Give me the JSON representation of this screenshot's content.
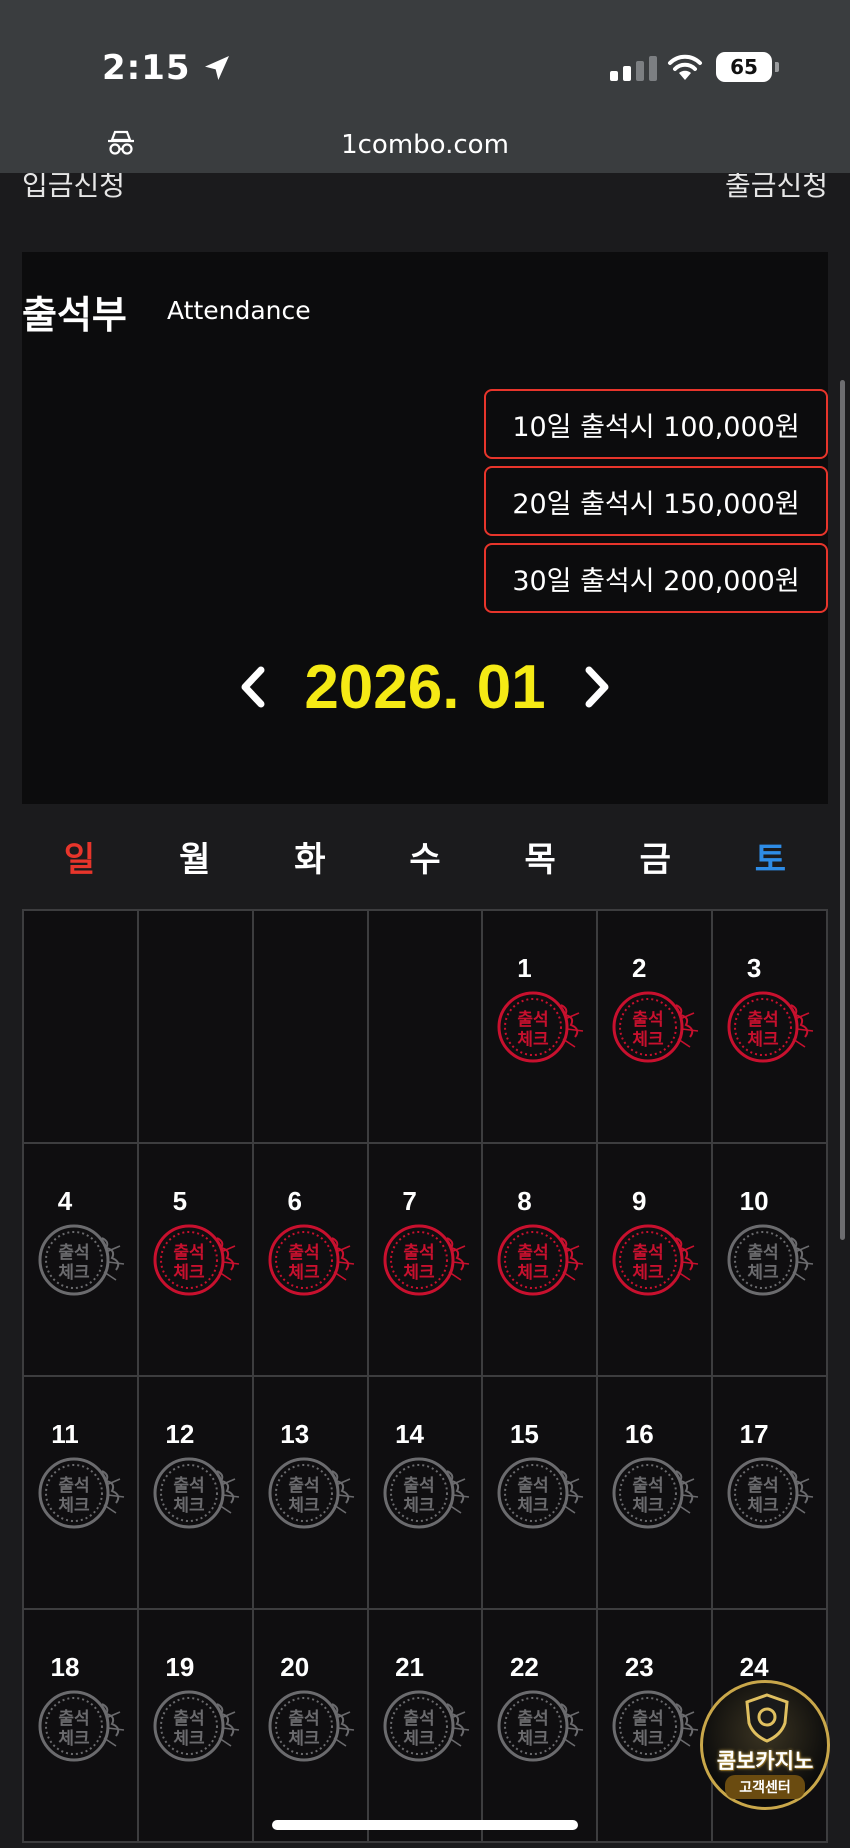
{
  "status_bar": {
    "time": "2:15",
    "battery": "65"
  },
  "browser": {
    "url": "1combo.com"
  },
  "top_links": {
    "left": "입금신청",
    "right": "출금신청"
  },
  "attendance": {
    "title": "출석부",
    "subtitle": "Attendance",
    "rewards": [
      "10일 출석시 100,000원",
      "20일 출석시 150,000원",
      "30일 출석시 200,000원"
    ],
    "month": "2026. 01"
  },
  "weekdays": [
    "일",
    "월",
    "화",
    "수",
    "목",
    "금",
    "토"
  ],
  "calendar": {
    "leading_blanks": 4,
    "days": [
      {
        "day": "1",
        "checked": true
      },
      {
        "day": "2",
        "checked": true
      },
      {
        "day": "3",
        "checked": true
      },
      {
        "day": "4",
        "checked": false
      },
      {
        "day": "5",
        "checked": true
      },
      {
        "day": "6",
        "checked": true
      },
      {
        "day": "7",
        "checked": true
      },
      {
        "day": "8",
        "checked": true
      },
      {
        "day": "9",
        "checked": true
      },
      {
        "day": "10",
        "checked": false
      },
      {
        "day": "11",
        "checked": false
      },
      {
        "day": "12",
        "checked": false
      },
      {
        "day": "13",
        "checked": false
      },
      {
        "day": "14",
        "checked": false
      },
      {
        "day": "15",
        "checked": false
      },
      {
        "day": "16",
        "checked": false
      },
      {
        "day": "17",
        "checked": false
      },
      {
        "day": "18",
        "checked": false
      },
      {
        "day": "19",
        "checked": false
      },
      {
        "day": "20",
        "checked": false
      },
      {
        "day": "21",
        "checked": false
      },
      {
        "day": "22",
        "checked": false
      },
      {
        "day": "23",
        "checked": false
      },
      {
        "day": "24",
        "checked": false
      }
    ],
    "stamp_text_top": "출석",
    "stamp_text_bottom": "체크",
    "checked_color": "#c8102e",
    "unchecked_color": "#6b6b6e"
  },
  "customer_center": {
    "name": "콤보카지노",
    "sub": "고객센터"
  },
  "icons": {
    "location": "location-arrow-icon",
    "privacy": "private-browsing-icon",
    "prev": "chevron-left-icon",
    "next": "chevron-right-icon"
  }
}
